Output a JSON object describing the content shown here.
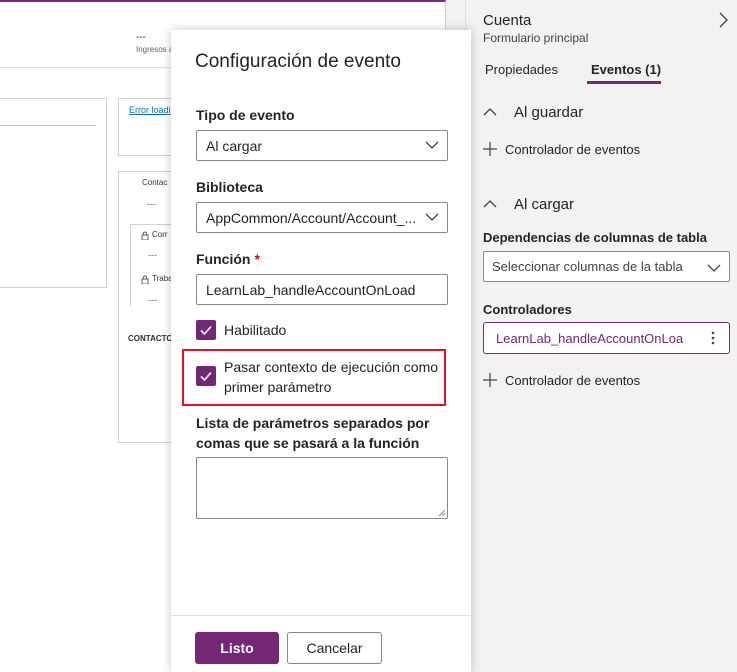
{
  "background_form": {
    "header_value": "---",
    "header_subtitle": "Ingresos a",
    "error_link": "Error loadi",
    "contact_label": "Contac",
    "contact_value": "---",
    "field1_label": "Corr",
    "field1_value": "---",
    "field2_label": "Traba",
    "field2_value": "---",
    "section_caps": "CONTACTO"
  },
  "dialog": {
    "title": "Configuración de evento",
    "event_type_label": "Tipo de evento",
    "event_type_value": "Al cargar",
    "library_label": "Biblioteca",
    "library_value": "AppCommon/Account/Account_...",
    "function_label": "Función",
    "function_required_mark": "*",
    "function_value": "LearnLab_handleAccountOnLoad",
    "enabled_label": "Habilitado",
    "enabled_checked": true,
    "pass_context_label_line1": "Pasar contexto de ejecución como",
    "pass_context_label_line2": "primer parámetro",
    "pass_context_checked": true,
    "params_label": "Lista de parámetros separados por comas que se pasará a la función",
    "params_value": "",
    "ok_button": "Listo",
    "cancel_button": "Cancelar",
    "highlight_color": "#e81123"
  },
  "right_panel": {
    "title": "Cuenta",
    "subtitle": "Formulario principal",
    "tabs": [
      {
        "label": "Propiedades",
        "active": false
      },
      {
        "label": "Eventos (1)",
        "active": true
      }
    ],
    "on_save": {
      "label": "Al guardar",
      "add_handler": "Controlador de eventos"
    },
    "on_load": {
      "label": "Al cargar",
      "dependencies_label": "Dependencias de columnas de tabla",
      "dependencies_placeholder": "Seleccionar columnas de la tabla",
      "handlers_label": "Controladores",
      "handler_value": "LearnLab_handleAccountOnLoa",
      "add_handler": "Controlador de eventos"
    }
  },
  "colors": {
    "accent": "#742774",
    "panel_bg": "#f3f2f1"
  }
}
